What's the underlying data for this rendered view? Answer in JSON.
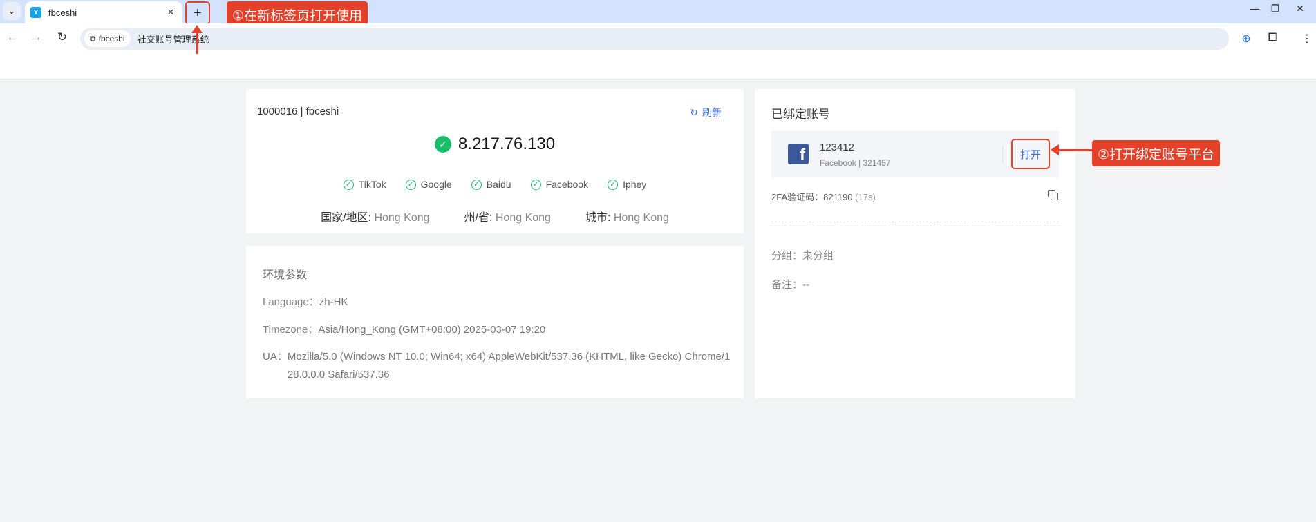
{
  "browser": {
    "tab_title": "fbceshi",
    "tab_favicon": "Y",
    "tab_list_icon": "⌄",
    "tab_close": "✕",
    "newtab_icon": "+",
    "site_chip": "fbceshi",
    "url": "社交账号管理系统",
    "window_controls": {
      "minimize": "—",
      "restore": "❐",
      "close": "✕"
    },
    "icons": [
      "back-icon",
      "forward-icon",
      "reload-icon",
      "globe-icon",
      "extensions-icon",
      "menu-icon"
    ]
  },
  "annotations": {
    "callout_1": "①在新标签页打开使用",
    "callout_2": "②打开绑定账号平台",
    "color": "#e4412b"
  },
  "ip_panel": {
    "account_id": "1000016 | fbceshi",
    "refresh_label": "刷新",
    "ip": "8.217.76.130",
    "checks": [
      "TikTok",
      "Google",
      "Baidu",
      "Facebook",
      "Iphey"
    ],
    "geo": {
      "country_label": "国家/地区:",
      "country": "Hong Kong",
      "state_label": "州/省:",
      "state": "Hong Kong",
      "city_label": "城市:",
      "city": "Hong Kong"
    },
    "status_color": "#19be6b"
  },
  "env_panel": {
    "title": "环境参数",
    "language_label": "Language：",
    "language": "zh-HK",
    "timezone_label": "Timezone：",
    "timezone": "Asia/Hong_Kong (GMT+08:00) 2025-03-07 19:20",
    "ua_label": "UA：",
    "ua": "Mozilla/5.0 (Windows NT 10.0; Win64; x64) AppleWebKit/537.36 (KHTML, like Gecko) Chrome/128.0.0.0 Safari/537.36"
  },
  "account_panel": {
    "title": "已绑定账号",
    "account_name": "123412",
    "account_sub": "Facebook | 321457",
    "open_label": "打开",
    "twofa_label": "2FA验证码：",
    "twofa_code": "821190",
    "twofa_seconds": "(17s)",
    "group_label": "分组：",
    "group_value": "未分组",
    "remark_label": "备注：",
    "remark_value": "--",
    "accent_color": "#3d6bf3"
  }
}
